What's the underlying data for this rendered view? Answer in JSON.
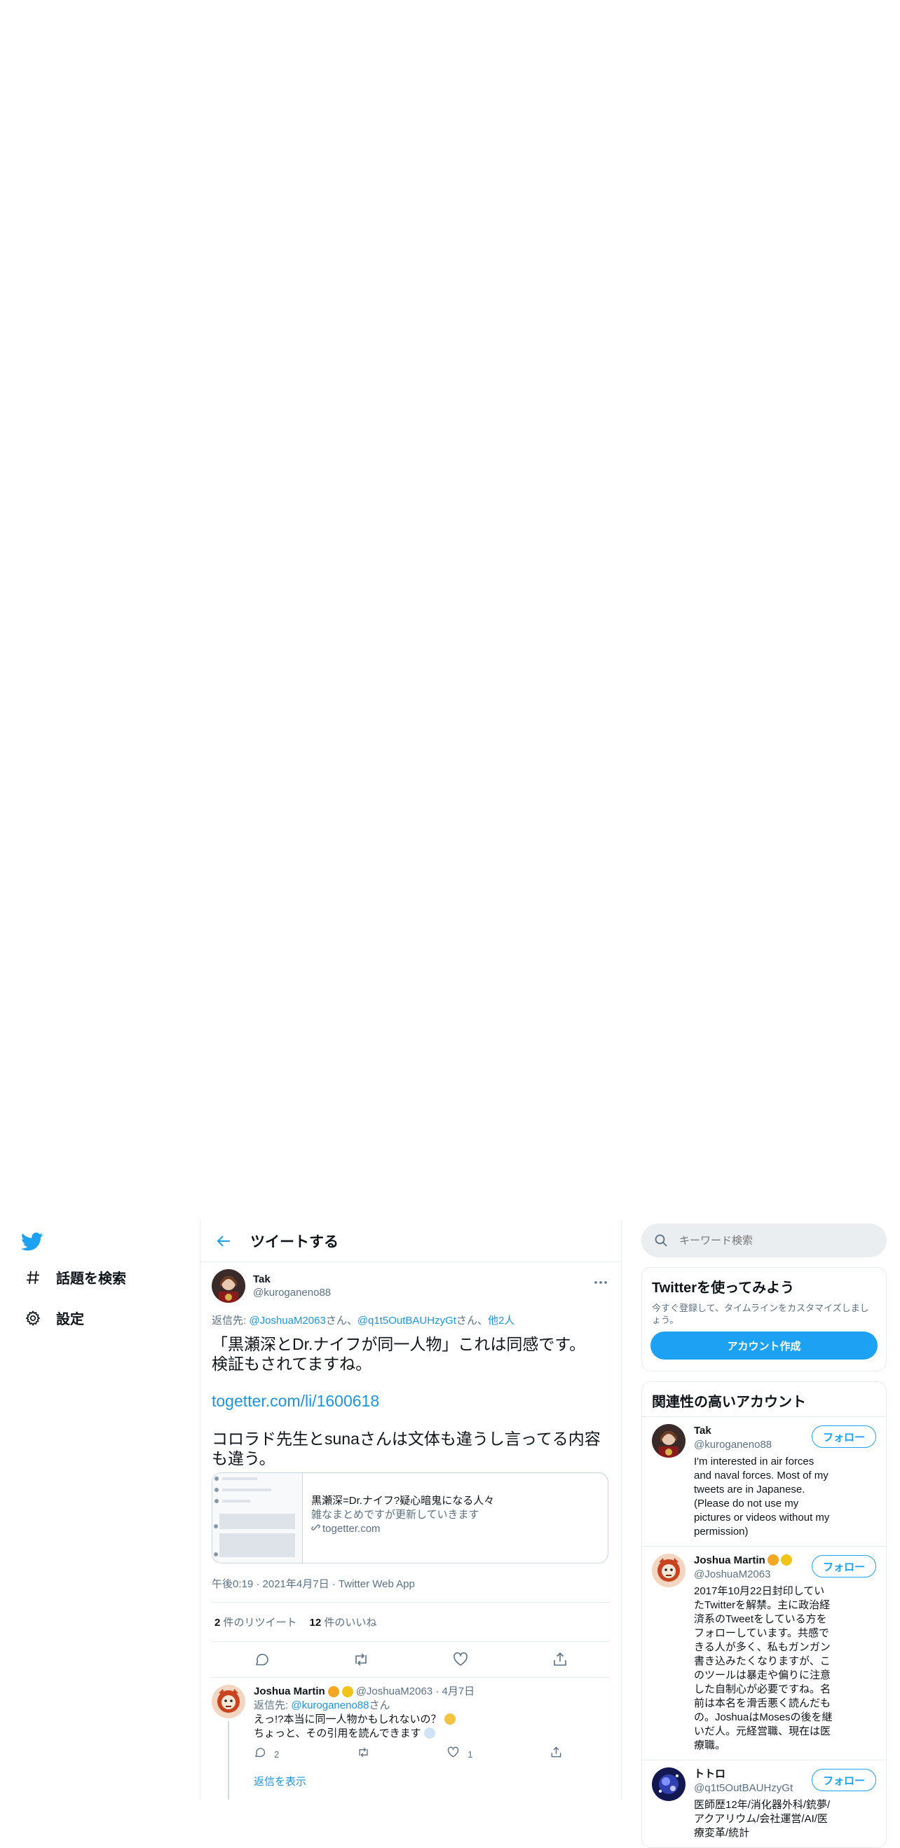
{
  "colors": {
    "accent": "#1da1f2",
    "link": "#1b95e0",
    "muted": "#5b7083",
    "border": "#e6ecf0"
  },
  "nav": {
    "logo_icon": "twitter-bird-icon",
    "items": [
      {
        "icon": "hashtag-icon",
        "label": "話題を検索"
      },
      {
        "icon": "gear-icon",
        "label": "設定"
      }
    ]
  },
  "header": {
    "title": "ツイートする"
  },
  "tweet": {
    "name": "Tak",
    "handle": "@kuroganeno88",
    "reply_prefix": "返信先: ",
    "reply_user1": "@JoshuaM2063",
    "reply_sep1": "さん、",
    "reply_user2": "@q1t5OutBAUHzyGt",
    "reply_sep2": "さん、",
    "reply_others": "他2人",
    "text1": "「黒瀬深とDr.ナイフが同一人物」これは同感です。\n検証もされてますね。",
    "link": "togetter.com/li/1600618",
    "text2": "コロラド先生とsunaさんは文体も違うし言ってる内容も違う。",
    "card": {
      "title": "黒瀬深=Dr.ナイフ?疑心暗鬼になる人々",
      "description": "雑なまとめですが更新していきます",
      "domain": "togetter.com"
    },
    "meta": "午後0:19 · 2021年4月7日 · Twitter Web App",
    "retweets_count": "2",
    "retweets_label": " 件のリツイート",
    "likes_count": "12",
    "likes_label": " 件のいいね"
  },
  "reply": {
    "name": "Joshua Martin",
    "handle_date": "@JoshuaM2063 · 4月7日",
    "reply_prefix": "返信先: ",
    "reply_user": "@kuroganeno88",
    "reply_suffix": "さん",
    "line1": "えっ!?本当に同一人物かもしれないの？",
    "line2": "ちょっと、その引用を読んできます",
    "reply_count": "2",
    "like_count": "1",
    "show_replies": "返信を表示"
  },
  "search": {
    "placeholder": "キーワード検索"
  },
  "signup": {
    "title": "Twitterを使ってみよう",
    "description": "今すぐ登録して、タイムラインをカスタマイズしましょう。",
    "button": "アカウント作成"
  },
  "related": {
    "title": "関連性の高いアカウント",
    "follow_label": "フォロー",
    "accounts": [
      {
        "name": "Tak",
        "handle": "@kuroganeno88",
        "bio": "I'm interested in air forces and naval forces. Most of my tweets are in Japanese. (Please do not use my pictures or videos without my permission)"
      },
      {
        "name": "Joshua Martin",
        "handle": "@JoshuaM2063",
        "bio": "2017年10月22日封印していたTwitterを解禁。主に政治経済系のTweetをしている方をフォローしています。共感できる人が多く、私もガンガン書き込みたくなりますが、このツールは暴走や偏りに注意した自制心が必要ですね。名前は本名を滑舌悪く読んだもの。JoshuaはMosesの後を継いだ人。元経営職、現在は医療職。"
      },
      {
        "name": "トトロ",
        "handle": "@q1t5OutBAUHzyGt",
        "bio": "医師歴12年/消化器外科/銃夢/アクアリウム/会社運営/AI/医療変革/統計"
      }
    ]
  }
}
